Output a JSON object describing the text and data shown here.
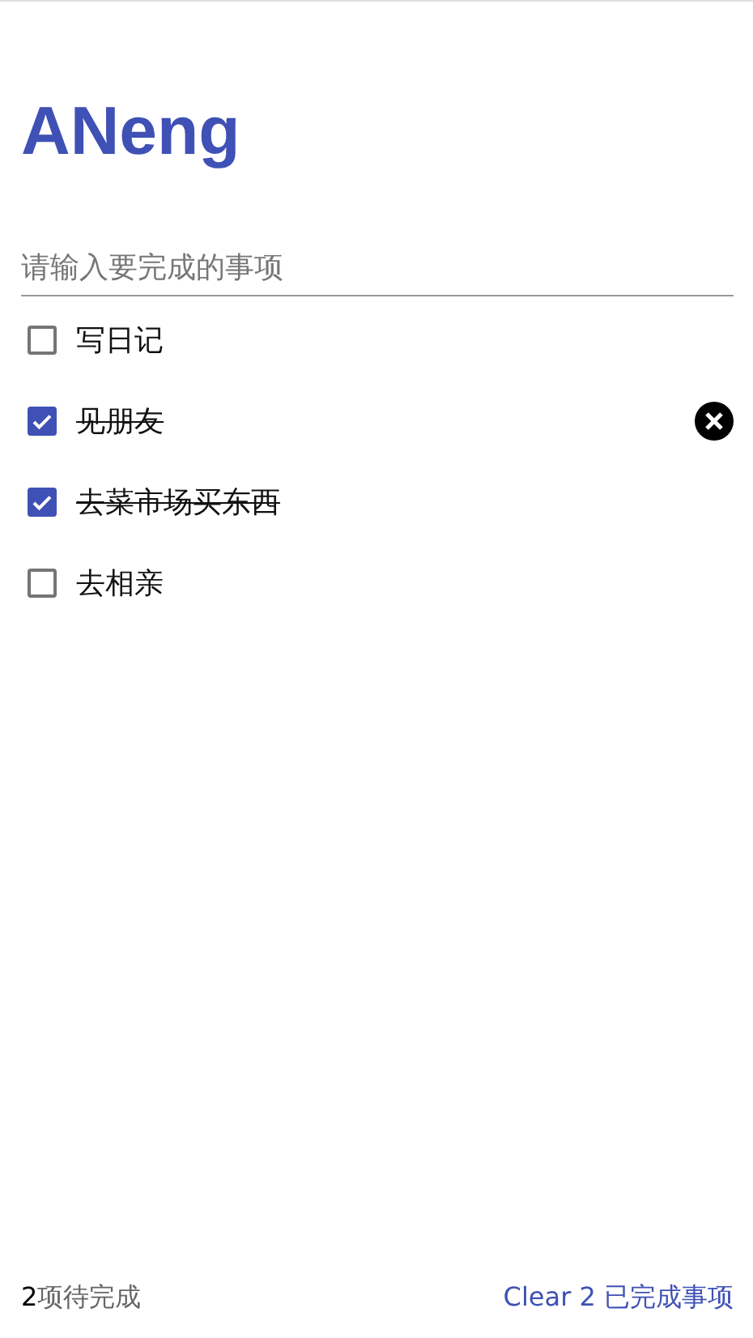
{
  "title": "ANeng",
  "new_todo": {
    "placeholder": "请输入要完成的事项"
  },
  "todos": [
    {
      "text": "写日记",
      "checked": false,
      "hovered": false
    },
    {
      "text": "见朋友",
      "checked": true,
      "hovered": true
    },
    {
      "text": "去菜市场买东西",
      "checked": true,
      "hovered": false
    },
    {
      "text": "去相亲",
      "checked": false,
      "hovered": false
    }
  ],
  "footer": {
    "count": "2",
    "count_label": "项待完成",
    "clear_link": "Clear 2 已完成事项"
  }
}
